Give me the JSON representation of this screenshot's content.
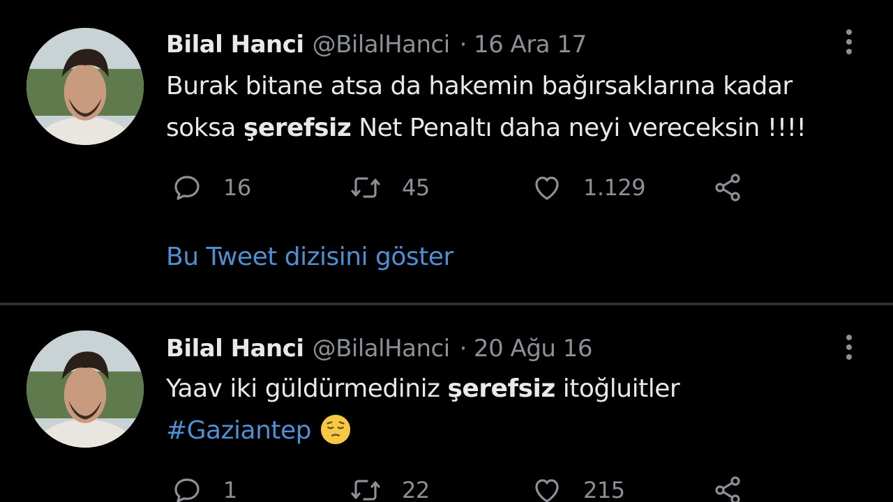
{
  "tweets": [
    {
      "name": "Bilal Hanci",
      "handle": "@BilalHanci",
      "separator": "·",
      "date": "16 Ara 17",
      "line1": "Burak bitane atsa da hakemin bağırsaklarına kadar",
      "line2_before": "soksa ",
      "line2_bold": "şerefsiz",
      "line2_after": " Net Penaltı daha neyi vereceksin !!!!",
      "stats": {
        "replies": "16",
        "retweets": "45",
        "likes": "1.129"
      },
      "thread_link": "Bu Tweet dizisini göster"
    },
    {
      "name": "Bilal Hanci",
      "handle": "@BilalHanci",
      "separator": "·",
      "date": "20 Ağu 16",
      "line1_before": "Yaav iki güldürmediniz ",
      "line1_bold": "şerefsiz",
      "line1_after": " itoğluitler",
      "hashtag": "#Gaziantep",
      "emoji": "pensive-face",
      "stats": {
        "replies": "1",
        "retweets": "22",
        "likes": "215"
      }
    }
  ],
  "icons": {
    "reply": "reply-icon",
    "retweet": "retweet-icon",
    "like": "heart-icon",
    "share": "share-icon",
    "more": "more-options-icon"
  },
  "colors": {
    "background": "#000000",
    "text": "#e7e9ea",
    "muted": "#8b9196",
    "link": "#4f8fd6",
    "divider": "#2b2d30"
  }
}
